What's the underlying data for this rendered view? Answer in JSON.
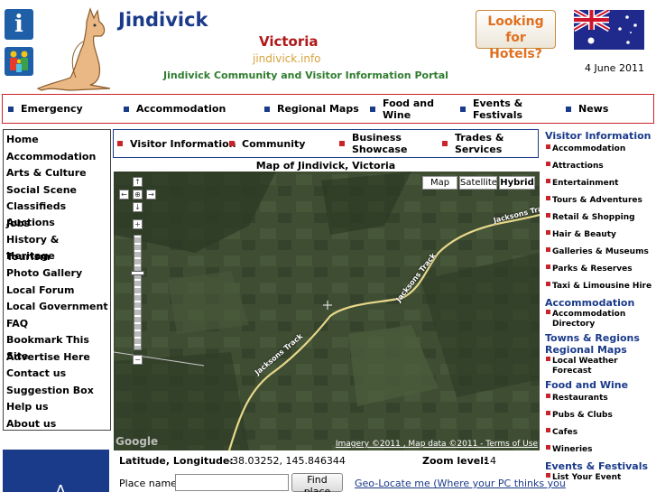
{
  "header": {
    "title": "Jindivick",
    "state": "Victoria",
    "domain": "jindivick.info",
    "tagline": "Jindivick Community and Visitor Information Portal",
    "hotels_button": [
      "Looking for",
      "Hotels?"
    ],
    "date": "4 June 2011",
    "info_icon_glyph": "i"
  },
  "top_nav": [
    {
      "label": "Emergency"
    },
    {
      "label": "Accommodation"
    },
    {
      "label": "Regional Maps"
    },
    {
      "label": "Food and Wine"
    },
    {
      "label": "Events & Festivals"
    },
    {
      "label": "News"
    }
  ],
  "left_nav": [
    "Home",
    "Accommodation",
    "Arts & Culture",
    "Social Scene",
    "Classifieds Auctions",
    "Jobs",
    "History & Heritage",
    "Tourism",
    "Photo Gallery",
    "Local Forum",
    "Local Government",
    "FAQ",
    "Bookmark This Site",
    "Advertise Here",
    "Contact us",
    "Suggestion Box",
    "Help us",
    "About us"
  ],
  "left_ad_text": "A",
  "sub_nav": [
    {
      "label": "Visitor Information"
    },
    {
      "label": "Community"
    },
    {
      "label": "Business Showcase"
    },
    {
      "label": "Trades & Services"
    }
  ],
  "map": {
    "title": "Map of Jindivick, Victoria",
    "types": [
      "Map",
      "Satellite",
      "Hybrid"
    ],
    "selected_type": "Hybrid",
    "road_name": "Jacksons Track",
    "copyright": "Imagery ©2011 , Map data ©2011 - Terms of Use",
    "logo": "Google",
    "pan_icons": [
      "↑",
      "←",
      "⊕",
      "→",
      "↓"
    ],
    "zoom_in_glyph": "+",
    "zoom_out_glyph": "−"
  },
  "coords": {
    "latlng_label": "Latitude, Longitude:",
    "latlng_value": "-38.03252, 145.846344",
    "zoom_label": "Zoom level:",
    "zoom_value": "14"
  },
  "search": {
    "place_label": "Place name:",
    "place_value": "",
    "find_button": "Find place",
    "geo_link": "Geo-Locate me (Where your PC thinks you"
  },
  "right_col": [
    {
      "heading": "Visitor Information",
      "items": [
        "Accommodation",
        "Attractions",
        "Entertainment",
        "Tours & Adventures",
        "Retail & Shopping",
        "Hair & Beauty",
        "Galleries & Museums",
        "Parks & Reserves",
        "Taxi & Limousine Hire"
      ]
    },
    {
      "heading": "Accommodation",
      "items": [
        "Accommodation Directory"
      ]
    },
    {
      "heading": "Towns & Regions",
      "items": []
    },
    {
      "heading": "Regional Maps",
      "items": [
        "Local Weather Forecast"
      ]
    },
    {
      "heading": "Food and Wine",
      "items": [
        "Restaurants",
        "Pubs & Clubs",
        "Cafes",
        "Wineries"
      ]
    },
    {
      "heading": "Events & Festivals",
      "items": [
        "List Your Event"
      ]
    }
  ],
  "colors": {
    "brand_blue": "#1a3a8a",
    "accent_red": "#c9242a",
    "portal_green": "#2f7d2f",
    "hotel_orange": "#e07020"
  }
}
